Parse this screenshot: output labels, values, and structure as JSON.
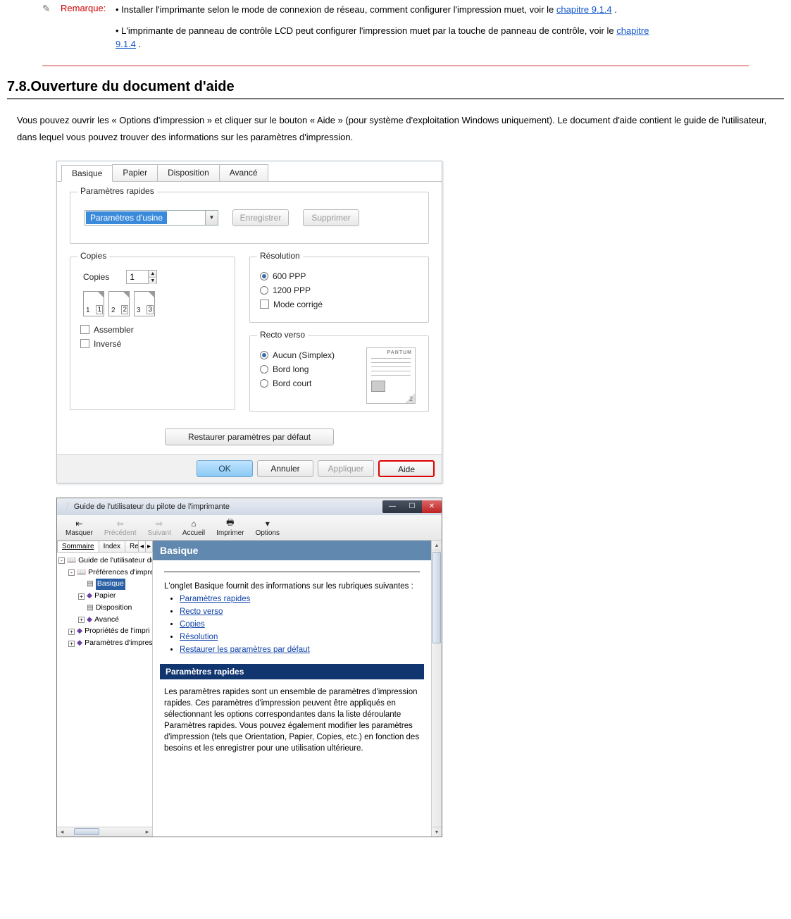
{
  "note": {
    "label": "Remarque:",
    "p1a": "• Installer l'imprimante selon le mode de connexion de réseau, comment configurer l'impression muet, voir le ",
    "p1link": "chapitre 9.1.4",
    "p1b": ".",
    "p2a": "• L'imprimante de panneau de contrôle LCD peut configurer l'impression muet par la touche de panneau de contrôle, voir le ",
    "p2link": "chapitre 9.1.4",
    "p2b": "."
  },
  "section": {
    "heading": "7.8.Ouverture du document d'aide",
    "intro": "Vous pouvez ouvrir les « Options d'impression » et cliquer sur le bouton « Aide » (pour système d'exploitation Windows uniquement). Le document d'aide contient le guide de l'utilisateur, dans lequel vous pouvez trouver des informations sur les paramètres d'impression."
  },
  "dialog": {
    "tabs": [
      "Basique",
      "Papier",
      "Disposition",
      "Avancé"
    ],
    "quick": {
      "title": "Paramètres rapides",
      "combo": "Paramètres d'usine",
      "save": "Enregistrer",
      "delete": "Supprimer"
    },
    "copies": {
      "title": "Copies",
      "label": "Copies",
      "value": "1",
      "assemble": "Assembler",
      "reverse": "Inversé",
      "pages": [
        "1",
        "1",
        "2",
        "2",
        "3",
        "3"
      ]
    },
    "resolution": {
      "title": "Résolution",
      "r600": "600 PPP",
      "r1200": "1200 PPP",
      "corr": "Mode corrigé"
    },
    "duplex": {
      "title": "Recto verso",
      "none": "Aucun (Simplex)",
      "long": "Bord long",
      "short": "Bord court",
      "brand": "PANTUM"
    },
    "restore": "Restaurer paramètres par défaut",
    "footer": {
      "ok": "OK",
      "cancel": "Annuler",
      "apply": "Appliquer",
      "help": "Aide"
    }
  },
  "help": {
    "title": "Guide de l'utilisateur du pilote de l'imprimante",
    "toolbar": {
      "hide": "Masquer",
      "back": "Précédent",
      "fwd": "Suivant",
      "home": "Accueil",
      "print": "Imprimer",
      "options": "Options"
    },
    "navtabs": [
      "Sommaire",
      "Index",
      "Recherche"
    ],
    "tree": {
      "root": "Guide de l'utilisateur du",
      "prefs": "Préférences d'impre",
      "basique": "Basique",
      "papier": "Papier",
      "dispo": "Disposition",
      "avance": "Avancé",
      "props": "Propriétés de l'impri",
      "params": "Paramètres d'impres"
    },
    "content": {
      "h1": "Basique",
      "lead": "L'onglet Basique fournit des informations sur les rubriques suivantes :",
      "links": [
        "Paramètres rapides",
        "Recto verso",
        "Copies",
        "Résolution",
        "Restaurer les paramètres par défaut"
      ],
      "sub": "Paramètres rapides",
      "para": "Les paramètres rapides sont un ensemble de paramètres d'impression rapides. Ces paramètres d'impression peuvent être appliqués en sélectionnant les options correspondantes dans la liste déroulante Paramètres rapides. Vous pouvez également modifier les paramètres d'impression (tels que Orientation, Papier, Copies, etc.) en fonction des besoins et les enregistrer pour une utilisation ultérieure."
    }
  }
}
